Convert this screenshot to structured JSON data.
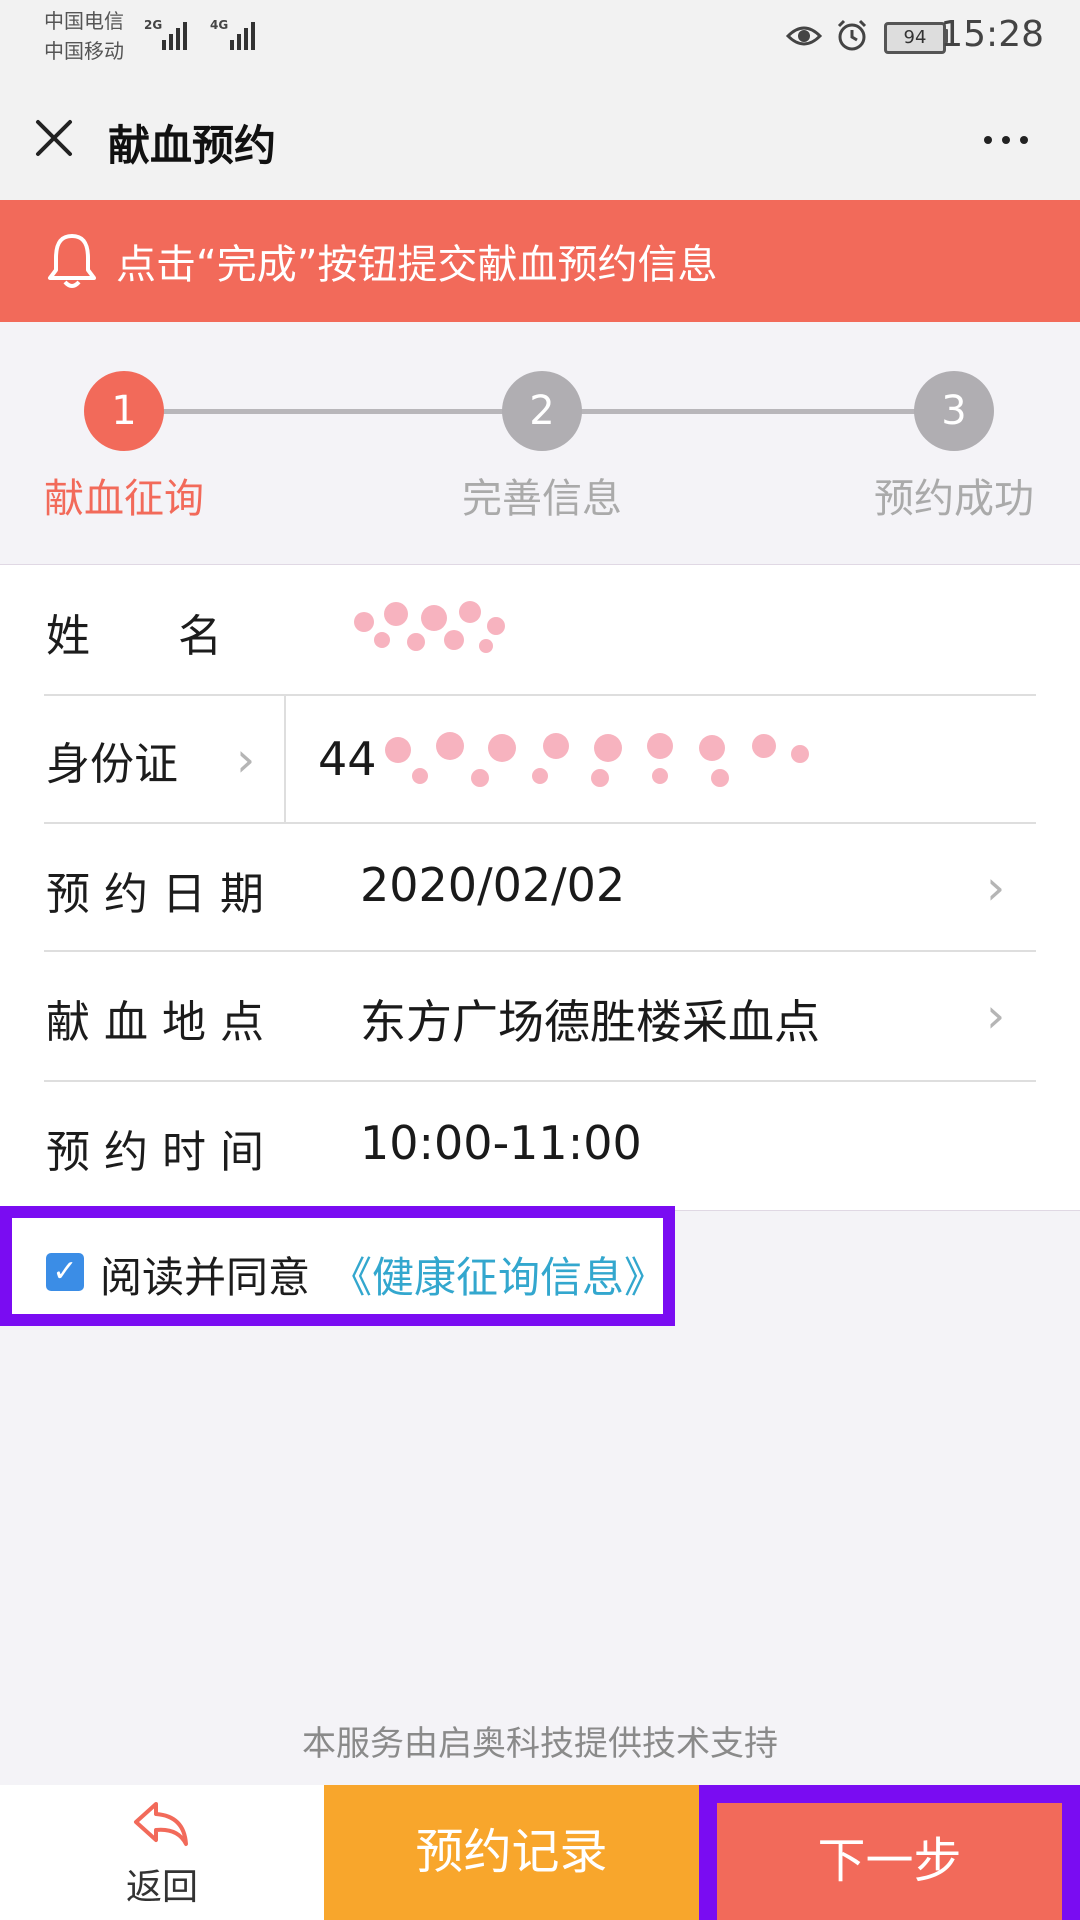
{
  "status_bar": {
    "carrier_1": "中国电信",
    "carrier_2": "中国移动",
    "net_1": "2G",
    "net_2": "4G",
    "battery": "94",
    "time": "15:28"
  },
  "nav": {
    "title": "献血预约",
    "close_icon": "close-icon",
    "more_icon": "more-icon"
  },
  "notice": {
    "text": "点击“完成”按钮提交献血预约信息",
    "icon": "bell-icon"
  },
  "stepper": {
    "steps": [
      {
        "number": "1",
        "label": "献血征询",
        "active": true
      },
      {
        "number": "2",
        "label": "完善信息",
        "active": false
      },
      {
        "number": "3",
        "label": "预约成功",
        "active": false
      }
    ],
    "active_color": "#f26a5a",
    "inactive_color": "#b0aeb2"
  },
  "form": {
    "name": {
      "label": "姓　　名",
      "value": ""
    },
    "id_card": {
      "label": "身份证",
      "value": "44"
    },
    "date": {
      "label": "预 约 日 期",
      "value": "2020/02/02"
    },
    "location": {
      "label": "献 血 地 点",
      "value": "东方广场德胜楼采血点"
    },
    "time": {
      "label": "预 约 时 间",
      "value": "10:00-11:00"
    }
  },
  "consent": {
    "checked": true,
    "text": "阅读并同意",
    "link": "《健康征询信息》"
  },
  "footer_note": "本服务由启奥科技提供技术支持",
  "bottom_bar": {
    "back_label": "返回",
    "record_label": "预约记录",
    "next_label": "下一步"
  },
  "colors": {
    "accent": "#f26a5a",
    "orange": "#f8a62c",
    "highlight": "#7a0cf2",
    "link": "#33a7ce"
  }
}
